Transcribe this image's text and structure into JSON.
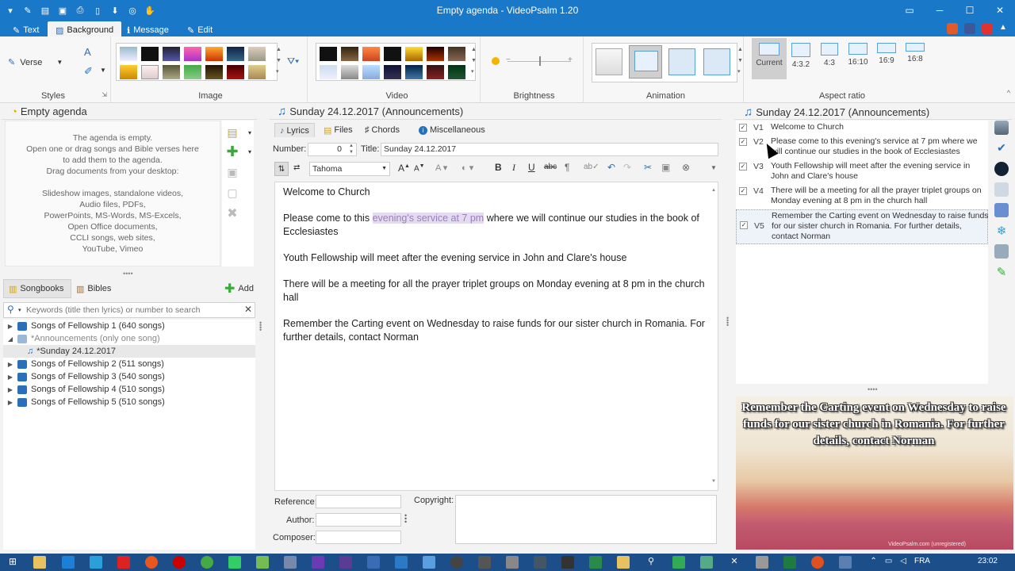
{
  "window": {
    "title": "Empty agenda - VideoPsalm 1.20"
  },
  "ribbon": {
    "tabs": [
      "Text",
      "Background",
      "Message",
      "Edit"
    ],
    "active_tab": "Background",
    "groups": {
      "styles": "Styles",
      "image": "Image",
      "video": "Video",
      "brightness": "Brightness",
      "animation": "Animation",
      "aspect_ratio": "Aspect ratio"
    },
    "verse_label": "Verse",
    "aspect_options": [
      "Current",
      "4:3.2",
      "4:3",
      "16:10",
      "16:9",
      "16:8"
    ]
  },
  "agenda": {
    "title": "Empty agenda",
    "empty_lines": [
      "The agenda is empty.",
      "Open one or drag songs and Bible verses here",
      "to add them to the agenda.",
      "Drag documents from your desktop:",
      "",
      "Slideshow images, standalone videos,",
      "Audio files, PDFs,",
      "PowerPoints, MS-Words, MS-Excels,",
      "Open Office documents,",
      "CCLI songs, web sites,",
      "YouTube, Vimeo"
    ]
  },
  "library": {
    "tabs": [
      "Songbooks",
      "Bibles"
    ],
    "add_label": "Add",
    "search_placeholder": "Keywords (title then lyrics) or number to search",
    "tree": [
      {
        "label": "Songs of Fellowship 1 (640 songs)",
        "level": 0,
        "expanded": false
      },
      {
        "label": "*Announcements (only one song)",
        "level": 0,
        "expanded": true
      },
      {
        "label": "*Sunday 24.12.2017",
        "level": 1,
        "expanded": false
      },
      {
        "label": "Songs of Fellowship 2 (511 songs)",
        "level": 0,
        "expanded": false
      },
      {
        "label": "Songs of Fellowship 3 (540 songs)",
        "level": 0,
        "expanded": false
      },
      {
        "label": "Songs of Fellowship 4 (510 songs)",
        "level": 0,
        "expanded": false
      },
      {
        "label": "Songs of Fellowship 5 (510 songs)",
        "level": 0,
        "expanded": false
      }
    ]
  },
  "editor": {
    "header": "Sunday 24.12.2017 (Announcements)",
    "tabs": [
      "Lyrics",
      "Files",
      "Chords",
      "Miscellaneous"
    ],
    "number_label": "Number:",
    "number_value": "0",
    "title_label": "Title:",
    "title_value": "Sunday 24.12.2017",
    "font": "Tahoma",
    "paragraphs": [
      {
        "before": "Welcome to Church",
        "highlight": "",
        "after": ""
      },
      {
        "before": "Please come to this ",
        "highlight": "evening's service at 7 pm",
        "after": " where we will continue our studies in the book of Ecclesiastes"
      },
      {
        "before": "Youth Fellowship will meet after the evening service in John and Clare's house",
        "highlight": "",
        "after": ""
      },
      {
        "before": "There will be a meeting for all the prayer triplet groups on Monday evening at 8 pm in the church hall",
        "highlight": "",
        "after": ""
      },
      {
        "before": "Remember the Carting event on Wednesday to raise funds for our sister church in Romania. For further details, contact Norman",
        "highlight": "",
        "after": ""
      }
    ],
    "reference_label": "Reference:",
    "author_label": "Author:",
    "composer_label": "Composer:",
    "copyright_label": "Copyright:"
  },
  "verses": {
    "header": "Sunday 24.12.2017 (Announcements)",
    "items": [
      {
        "label": "V1",
        "text": "Welcome to Church"
      },
      {
        "label": "V2",
        "text": "Please come to this evening's service at 7 pm where we will continue our studies in the book of Ecclesiastes"
      },
      {
        "label": "V3",
        "text": "Youth Fellowship will meet after the evening service in John and Clare's house"
      },
      {
        "label": "V4",
        "text": "There will be a meeting for all the prayer triplet groups on Monday evening at 8 pm in the church hall"
      },
      {
        "label": "V5",
        "text": "Remember the Carting event on Wednesday to raise funds for our sister church in Romania. For further details, contact Norman"
      }
    ]
  },
  "preview": {
    "text": "Remember the Carting event on Wednesday to raise funds for our sister church in Romania. For further details, contact Norman",
    "watermark": "VideoPsalm.com (unregistered)"
  },
  "taskbar": {
    "lang": "FRA",
    "time": "23:02"
  },
  "colors": {
    "titlebar": "#1a78c8",
    "taskbar": "#1c4f8a",
    "highlight_text": "#9b7fb8"
  }
}
